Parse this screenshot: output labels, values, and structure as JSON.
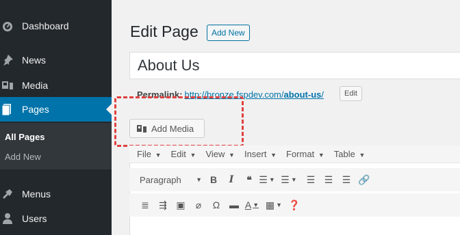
{
  "sidebar": {
    "items": [
      {
        "label": "Dashboard",
        "icon": "dashboard-icon"
      },
      {
        "label": "News",
        "icon": "pushpin-icon"
      },
      {
        "label": "Media",
        "icon": "media-icon"
      },
      {
        "label": "Pages",
        "icon": "pages-icon",
        "active": true
      },
      {
        "label": "Menus",
        "icon": "menus-icon"
      },
      {
        "label": "Users",
        "icon": "users-icon"
      }
    ],
    "submenu": [
      {
        "label": "All Pages",
        "current": true
      },
      {
        "label": "Add New"
      }
    ]
  },
  "header": {
    "title": "Edit Page",
    "add_new_label": "Add New"
  },
  "post": {
    "title_value": "About Us",
    "permalink_label": "Permalink:",
    "permalink_base": "http://bronze.fspdev.com/",
    "permalink_slug": "about-us",
    "permalink_trailing": "/",
    "edit_label": "Edit"
  },
  "media": {
    "add_media_label": "Add Media",
    "highlight_color": "#e0413f"
  },
  "editor": {
    "menubar": [
      "File",
      "Edit",
      "View",
      "Insert",
      "Format",
      "Table"
    ],
    "format_select": "Paragraph"
  },
  "colors": {
    "sidebar_bg": "#23282d",
    "active_bg": "#0073aa",
    "link": "#0073aa"
  }
}
